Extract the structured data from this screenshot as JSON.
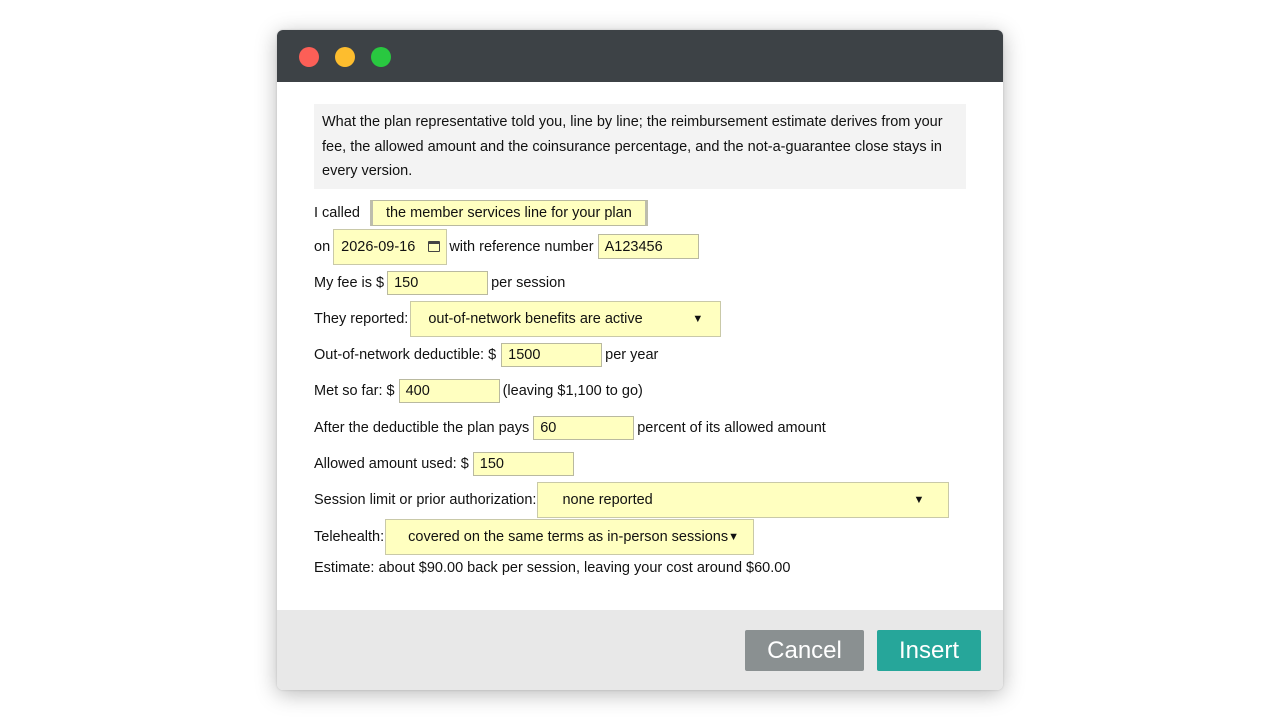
{
  "intro_text": "What the plan representative told you, line by line; the reimbursement estimate derives from your fee, the allowed amount and the coinsurance percentage, and the not-a-guarantee close stays in every version.",
  "called": {
    "label": "I called",
    "value": "the member services line for your plan"
  },
  "date_row": {
    "on_label": "on",
    "date": "2026-09-16",
    "ref_label": "with reference number",
    "ref_value": "A123456"
  },
  "fee": {
    "label": "My fee is $",
    "value": "150",
    "suffix": "per session"
  },
  "reported": {
    "label": "They reported:",
    "value": "out-of-network benefits are active"
  },
  "deductible": {
    "label": "Out-of-network deductible: $",
    "value": "1500",
    "suffix": "per year"
  },
  "met": {
    "label": "Met so far: $",
    "value": "400",
    "suffix": "(leaving $1,100 to go)"
  },
  "coinsurance": {
    "label": "After the deductible the plan pays",
    "value": "60",
    "suffix": "percent of its allowed amount"
  },
  "allowed": {
    "label": "Allowed amount used: $",
    "value": "150"
  },
  "session_limit": {
    "label": "Session limit or prior authorization:",
    "value": "none reported"
  },
  "telehealth": {
    "label": "Telehealth:",
    "value": "covered on the same terms as in-person sessions"
  },
  "estimate": "Estimate: about $90.00 back per session, leaving your cost around $60.00",
  "buttons": {
    "cancel": "Cancel",
    "insert": "Insert"
  },
  "colors": {
    "titlebar": "#3d4246",
    "field_bg": "#ffffc0",
    "insert": "#26a69a",
    "cancel": "#8a9091"
  }
}
